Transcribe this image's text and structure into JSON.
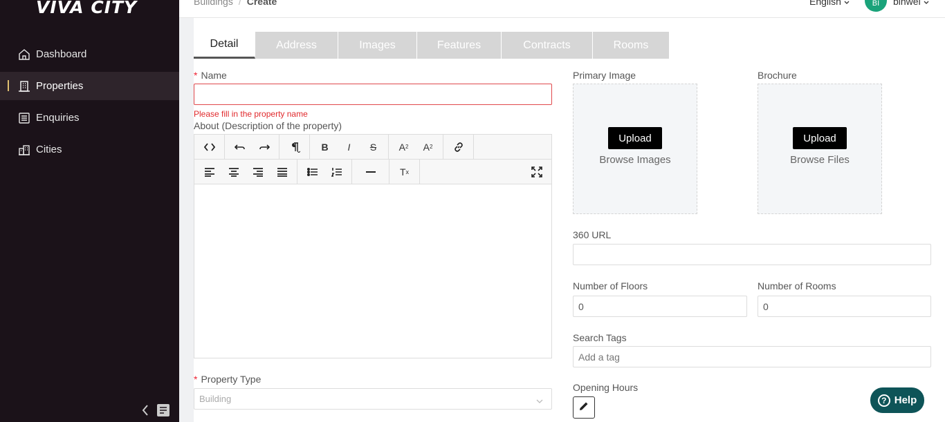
{
  "app": {
    "logo": "VIVA CITY"
  },
  "sidebar": {
    "items": [
      {
        "label": "Dashboard",
        "icon": "home-icon"
      },
      {
        "label": "Properties",
        "icon": "building-icon",
        "active": true
      },
      {
        "label": "Enquiries",
        "icon": "list-icon"
      },
      {
        "label": "Cities",
        "icon": "city-icon"
      }
    ]
  },
  "header": {
    "breadcrumb": [
      "Buildings",
      "Create"
    ],
    "language": "English",
    "avatar_initials": "BI",
    "username": "binwei"
  },
  "tabs": [
    "Detail",
    "Address",
    "Images",
    "Features",
    "Contracts",
    "Rooms"
  ],
  "form": {
    "name_label": "Name",
    "name_value": "",
    "name_error": "Please fill in the property name",
    "about_label": "About (Description of the property)",
    "property_type_label": "Property Type",
    "property_type_placeholder": "Building",
    "primary_image_label": "Primary Image",
    "primary_upload_button": "Upload",
    "primary_upload_sub": "Browse Images",
    "brochure_label": "Brochure",
    "brochure_upload_button": "Upload",
    "brochure_upload_sub": "Browse Files",
    "url360_label": "360 URL",
    "url360_value": "",
    "floors_label": "Number of Floors",
    "floors_value": "0",
    "rooms_label": "Number of Rooms",
    "rooms_value": "0",
    "tags_label": "Search Tags",
    "tags_placeholder": "Add a tag",
    "opening_hours_label": "Opening Hours"
  },
  "help": {
    "label": "Help"
  },
  "colors": {
    "sidebar_bg": "#1b1219",
    "accent": "#0e5458",
    "error": "#e0282b",
    "avatar": "#1aa37a"
  }
}
